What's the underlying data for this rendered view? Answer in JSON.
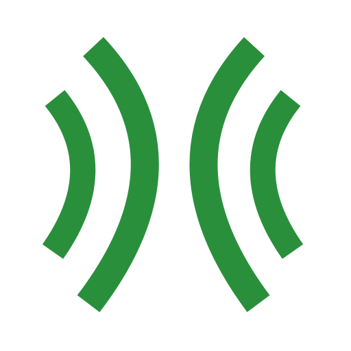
{
  "icon": {
    "name": "signal-waves-icon",
    "color": "#2a8f3b",
    "background": "#ffffff"
  }
}
